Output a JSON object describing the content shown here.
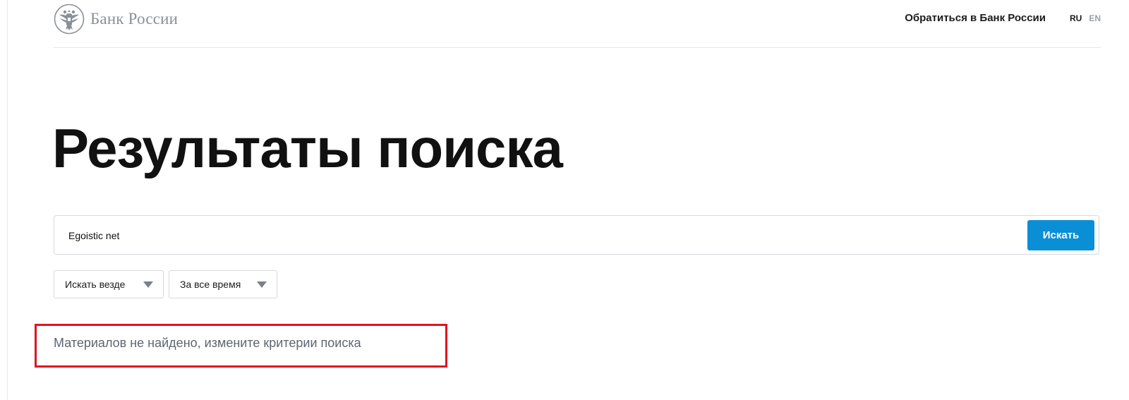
{
  "header": {
    "logo_text": "Банк России",
    "contact_label": "Обратиться в Банк России",
    "languages": {
      "ru": "RU",
      "en": "EN",
      "active": "RU"
    }
  },
  "main": {
    "title": "Результаты поиска",
    "search": {
      "value": "Egoistic net",
      "placeholder": "",
      "button_label": "Искать"
    },
    "filters": [
      {
        "label": "Искать везде"
      },
      {
        "label": "За все время"
      }
    ],
    "empty_message": "Материалов не найдено, измените критерии поиска"
  },
  "colors": {
    "accent": "#0a8fd6",
    "highlight": "#e0141e",
    "muted_text": "#5f6670",
    "logo_gray": "#8a9099"
  },
  "icons": {
    "logo": "double-headed-eagle-icon",
    "dropdown": "chevron-down-icon"
  }
}
